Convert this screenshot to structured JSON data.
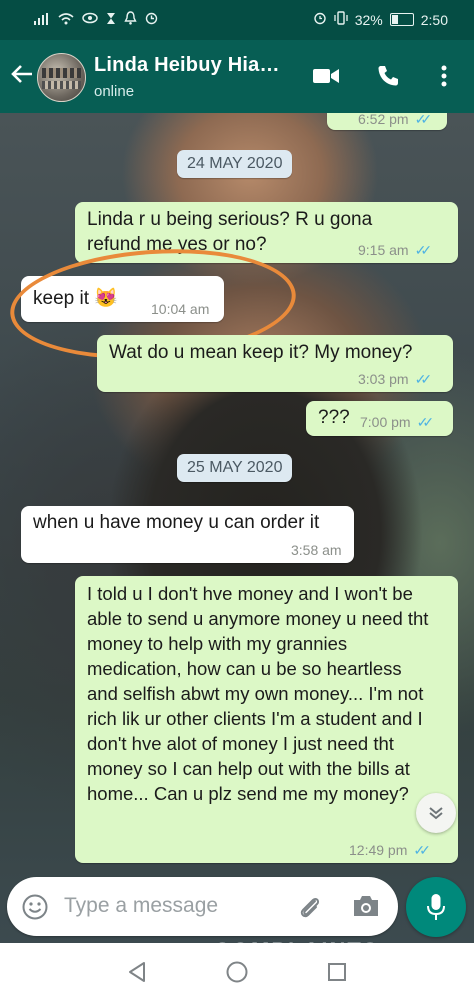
{
  "status_bar": {
    "battery": "32%",
    "time": "2:50",
    "battery_level": 0.32
  },
  "header": {
    "contact_name": "Linda Heibuy Hia…",
    "status": "online"
  },
  "messages": [
    {
      "direction": "out",
      "text": "?",
      "time": "6:52 pm",
      "read": true
    },
    {
      "type": "date",
      "text": "24 MAY 2020"
    },
    {
      "direction": "out",
      "text": "Linda r u being serious? R u gona refund me yes or no?",
      "time": "9:15 am",
      "read": true
    },
    {
      "direction": "in",
      "text": "keep it 😻",
      "time": "10:04 am"
    },
    {
      "direction": "out",
      "text": "Wat do u mean keep it? My money?",
      "time": "3:03 pm",
      "read": true
    },
    {
      "direction": "out",
      "text": "???",
      "time": "7:00 pm",
      "read": true
    },
    {
      "type": "date",
      "text": "25 MAY 2020"
    },
    {
      "direction": "in",
      "text": "when u have money u can order it",
      "time": "3:58 am"
    },
    {
      "direction": "out",
      "text": "I told u I don't hve money and I won't be able to send u anymore money u need tht money to help with my grannies medication, how can u be so heartless and selfish abwt my own money... I'm not rich lik ur other clients I'm a student and I don't hve alot of money I just need tht money so I can help out with the bills at home... Can u plz send me my money?",
      "time": "12:49 pm",
      "read": true
    }
  ],
  "input": {
    "placeholder": "Type a message"
  },
  "watermark": "COMPLAINTS",
  "colors": {
    "header": "#075e54",
    "outgoing_bubble": "#dcf8c6",
    "incoming_bubble": "#ffffff",
    "read_tick": "#4fb3e3",
    "annotation_circle": "#e98a3a"
  }
}
